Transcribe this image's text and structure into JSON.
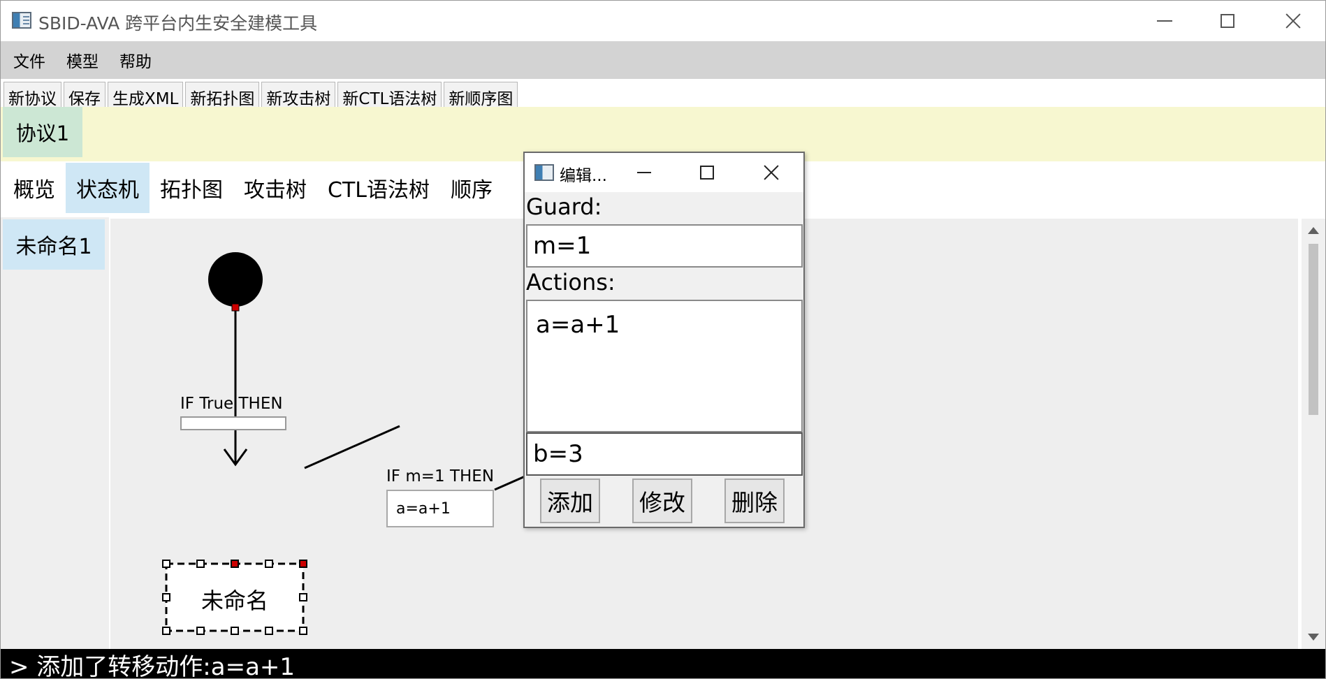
{
  "window": {
    "title": "SBID-AVA 跨平台内生安全建模工具"
  },
  "menu": {
    "items": [
      "文件",
      "模型",
      "帮助"
    ]
  },
  "toolbar": {
    "buttons": [
      "新协议",
      "保存",
      "生成XML",
      "新拓扑图",
      "新攻击树",
      "新CTL语法树",
      "新顺序图"
    ]
  },
  "protocol_tabs": {
    "active": "协议1"
  },
  "view_tabs": {
    "items": [
      "概览",
      "状态机",
      "拓扑图",
      "攻击树",
      "CTL语法树",
      "顺序"
    ],
    "active_index": 1
  },
  "state_machines": {
    "items": [
      "未命名1"
    ]
  },
  "canvas": {
    "transitions": [
      {
        "guard": "IF True THEN",
        "action": ""
      },
      {
        "guard": "IF m=1 THEN",
        "action": "a=a+1"
      }
    ],
    "states": [
      {
        "name": "未命名",
        "selected": true
      }
    ],
    "colors": {
      "background": "#eeeeee",
      "anchor": "#cc0000",
      "stroke": "#000000"
    }
  },
  "dialog": {
    "title": "编辑...",
    "guard_label": "Guard:",
    "guard_value": "m=1",
    "actions_label": "Actions:",
    "actions": [
      "a=a+1"
    ],
    "new_action_value": "b=3",
    "add_label": "添加",
    "modify_label": "修改",
    "delete_label": "删除"
  },
  "status": {
    "message": "> 添加了转移动作:a=a+1"
  }
}
